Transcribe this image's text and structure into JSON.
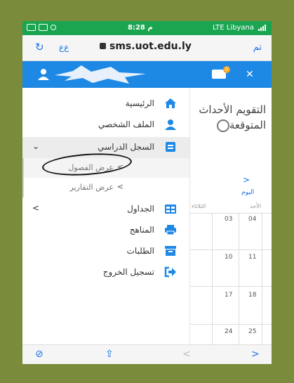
{
  "status_bar": {
    "time": "8:28 م",
    "carrier": "LTE  Libyana"
  },
  "browser": {
    "aa_label": "ﻉﻉ",
    "url": "sms.uot.edu.ly",
    "done_label": "تم"
  },
  "header": {
    "mail_badge": "0"
  },
  "menu": {
    "home": "الرئيسية",
    "profile": "الملف الشخصي",
    "academic_record": "السجل الدراسي",
    "view_classes": "عرض الفصول",
    "view_reports": "عرض التقارير",
    "schedules": "الجداول",
    "curricula": "المناهج",
    "requests": "الطلبات",
    "logout": "تسجيل الخروج"
  },
  "calendar": {
    "title": "التقويم الأحداث المتوقعة",
    "today": "اليوم",
    "day_headers": [
      "الأحد",
      "الثلاثاء"
    ],
    "dates": [
      [
        "04",
        "03"
      ],
      [
        "11",
        "10"
      ],
      [
        "18",
        "17"
      ],
      [
        "25",
        "24"
      ]
    ]
  },
  "colors": {
    "primary": "#1e88e5",
    "status_green": "#1aa550",
    "frame_olive": "#7a8c3c"
  },
  "icons": [
    "home-icon",
    "profile-icon",
    "record-icon",
    "table-icon",
    "printer-icon",
    "requests-icon",
    "logout-icon"
  ]
}
